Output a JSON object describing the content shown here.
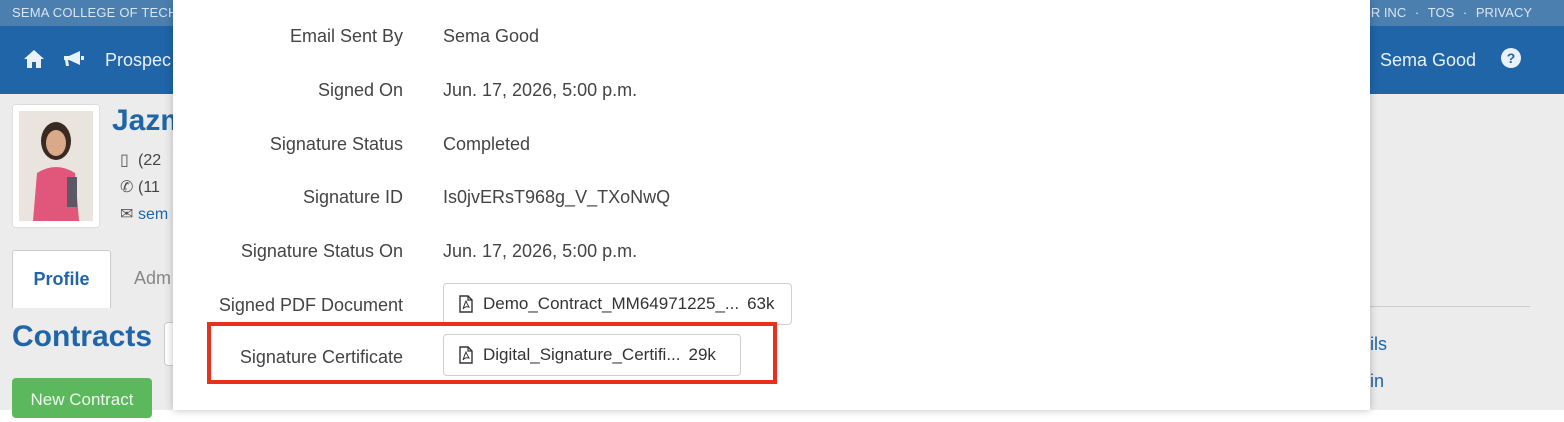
{
  "topbar": {
    "school": "SEMA COLLEGE OF TECH",
    "vendor": "OR INC",
    "sep1": "·",
    "tos": "TOS",
    "sep2": "·",
    "privacy": "PRIVACY"
  },
  "navbar": {
    "link": "Prospec",
    "user_name": "Sema Good",
    "icons": [
      "home-icon",
      "megaphone-icon",
      "help-icon"
    ]
  },
  "profile": {
    "name": "Jazm",
    "phone1": "(22",
    "phone2": "(11",
    "email": "sem"
  },
  "tabs": {
    "profile": "Profile",
    "adm": "Adm"
  },
  "contracts": {
    "heading": "Contracts",
    "new_button": "New Contract"
  },
  "right_links": {
    "link1": "ils",
    "link2": "in"
  },
  "modal": {
    "rows": [
      {
        "label": "Email Sent By",
        "value": "Sema Good"
      },
      {
        "label": "Signed On",
        "value": "Jun. 17, 2026, 5:00 p.m."
      },
      {
        "label": "Signature Status",
        "value": "Completed"
      },
      {
        "label": "Signature ID",
        "value": "Is0jvERsT968g_V_TXoNwQ"
      },
      {
        "label": "Signature Status On",
        "value": "Jun. 17, 2026, 5:00 p.m."
      }
    ],
    "signed_pdf": {
      "label": "Signed PDF Document",
      "filename": "Demo_Contract_MM64971225_...",
      "size": "63k",
      "icon": "pdf-file-icon"
    },
    "certificate": {
      "label": "Signature Certificate",
      "filename": "Digital_Signature_Certifi...",
      "size": "29k",
      "icon": "pdf-file-icon"
    }
  },
  "colors": {
    "brand": "#1f65a8",
    "topbar": "#4a7fb0",
    "highlight": "#e8301c",
    "success": "#5cb85c"
  }
}
